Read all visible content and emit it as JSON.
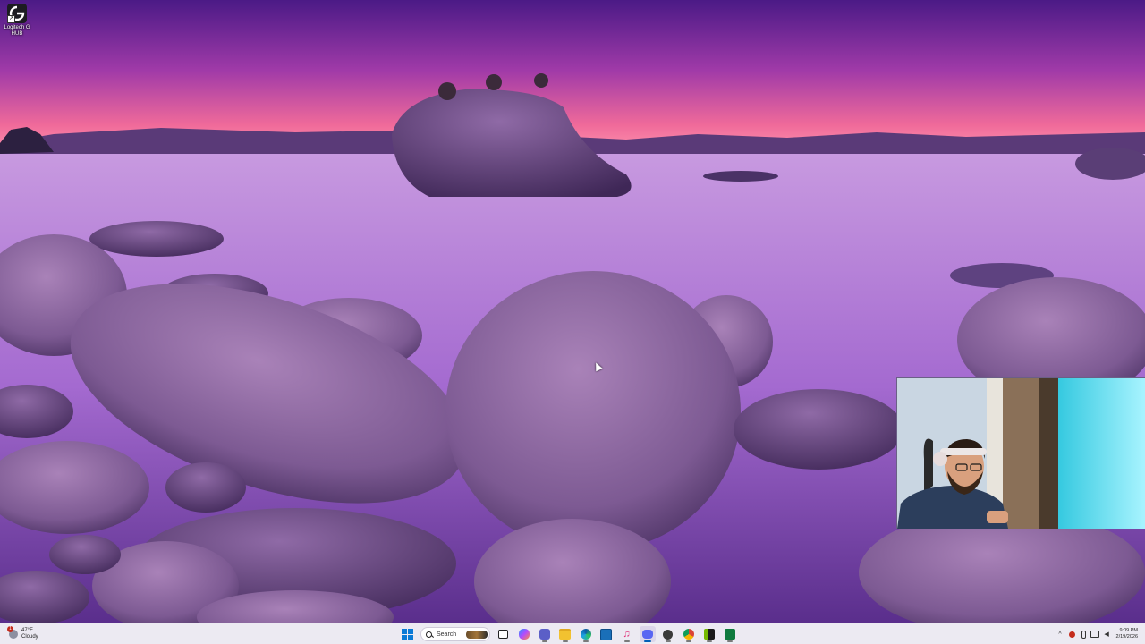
{
  "desktop": {
    "icons": [
      {
        "label_line1": "Logitech G",
        "label_line2": "HUB",
        "icon": "logitech-g-icon"
      }
    ]
  },
  "taskbar": {
    "weather": {
      "temperature": "47°F",
      "condition": "Cloudy",
      "alert_count": "1"
    },
    "search": {
      "placeholder": "Search"
    },
    "apps": [
      {
        "name": "start",
        "icon": "windows-start-icon"
      },
      {
        "name": "search",
        "icon": "search-icon"
      },
      {
        "name": "task-view",
        "icon": "task-view-icon"
      },
      {
        "name": "copilot",
        "icon": "copilot-icon"
      },
      {
        "name": "teams",
        "icon": "teams-icon"
      },
      {
        "name": "file-explorer",
        "icon": "folder-icon"
      },
      {
        "name": "edge",
        "icon": "edge-icon"
      },
      {
        "name": "store",
        "icon": "store-icon"
      },
      {
        "name": "itunes",
        "icon": "music-note-icon"
      },
      {
        "name": "discord",
        "icon": "discord-icon",
        "active": true
      },
      {
        "name": "obs",
        "icon": "hexagon-icon"
      },
      {
        "name": "chrome",
        "icon": "chrome-icon"
      },
      {
        "name": "nvidia",
        "icon": "nvidia-icon"
      },
      {
        "name": "android-studio",
        "icon": "android-icon"
      }
    ],
    "tray": {
      "icons": [
        "chevron-up-icon",
        "security-icon",
        "microphone-icon",
        "speaker-icon",
        "network-icon"
      ],
      "time": "9:09 PM",
      "date": "2/19/2026"
    }
  },
  "colors": {
    "taskbar_bg": "#eceaf2",
    "accent": "#005fb8",
    "wallpaper_sky_top": "#5a1f8c",
    "wallpaper_horizon": "#ff8fa6",
    "wallpaper_water": "#b47ad8"
  }
}
